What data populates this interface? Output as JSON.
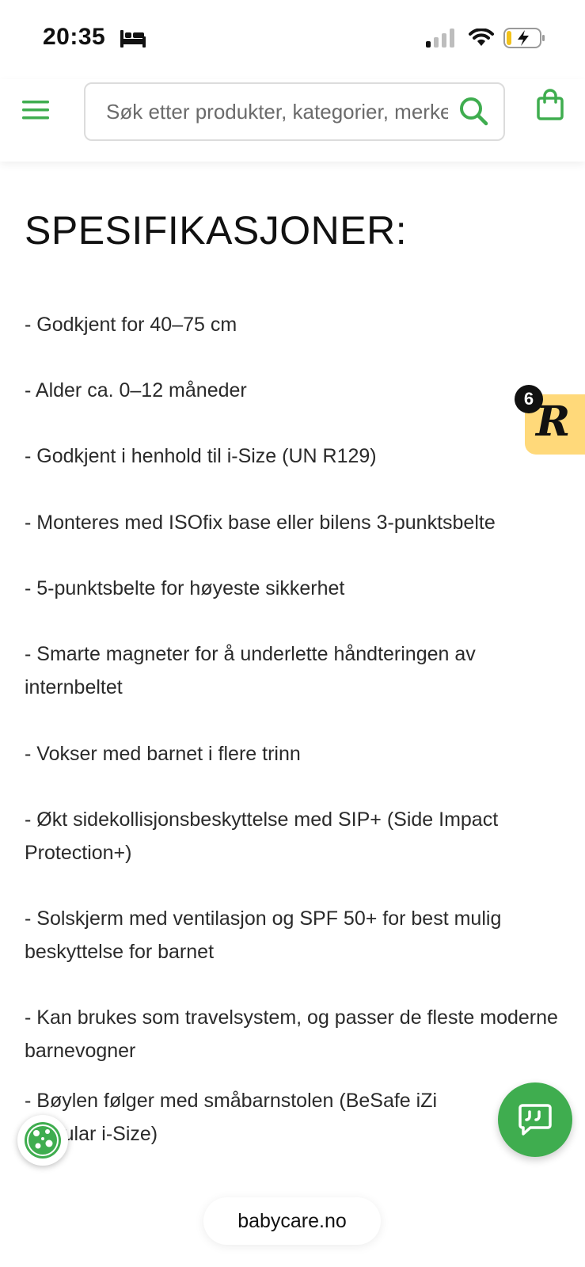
{
  "status_bar": {
    "time": "20:35"
  },
  "header": {
    "search_placeholder": "Søk etter produkter, kategorier, merker"
  },
  "content": {
    "title": "SPESIFIKASJONER:",
    "specs": [
      "- Godkjent for 40–75 cm",
      "- Alder ca. 0–12 måneder",
      "- Godkjent i henhold til i-Size (UN R129)",
      "- Monteres med ISOfix base eller bilens 3-punktsbelte",
      "- 5-punktsbelte for høyeste sikkerhet",
      "- Smarte magneter for å underlette håndteringen av internbeltet",
      "- Vokser med barnet i flere trinn",
      "- Økt sidekollisjonsbeskyttelse med SIP+ (Side Impact Protection+)",
      "- Solskjerm med ventilasjon og SPF 50+ for best mulig beskyttelse for barnet",
      "- Kan brukes som travelsystem, og passer de fleste moderne barnevogner",
      "- Bøylen følger med småbarnstolen (BeSafe iZi Modular i-Size)"
    ]
  },
  "reviews_badge": {
    "letter": "R",
    "count": "6"
  },
  "browser": {
    "url": "babycare.no"
  },
  "colors": {
    "accent": "#3fad4f",
    "badge": "#ffd97a"
  },
  "icons": [
    "bed-icon",
    "signal-icon",
    "wifi-icon",
    "battery-charging-icon",
    "menu-icon",
    "search-icon",
    "shopping-bag-icon",
    "chat-icon",
    "cookie-icon"
  ]
}
